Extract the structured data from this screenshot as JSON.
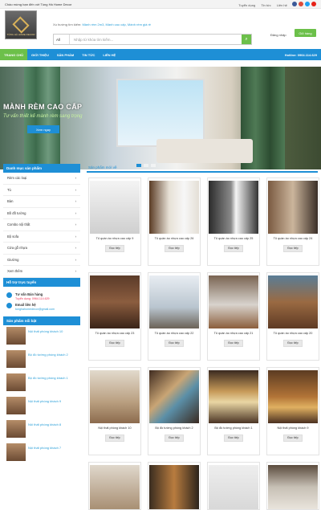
{
  "topbar": {
    "welcome": "Chào mừng bạn đến với Tùng Hà Home Decor",
    "links": [
      "Tuyển dụng",
      "Tin tức",
      "Liên hệ"
    ]
  },
  "logo": {
    "text": "TÙNG HÀ HOME DECOR"
  },
  "search": {
    "keywords_label": "Xu hướng tìm kiếm:",
    "keywords": "Mành rèm 2m3, Mành cao cấp, Mành rèm giá rẻ",
    "category": "All",
    "placeholder": "Nhập từ khóa tìm kiếm..."
  },
  "account": {
    "login": "Đăng nhập",
    "cart": "Giỏ hàng"
  },
  "nav": {
    "items": [
      "TRANG CHỦ",
      "GIỚI THIỆU",
      "SẢN PHẨM",
      "TIN TỨC",
      "LIÊN HỆ"
    ],
    "hotline": "Hotline: 0964.114.629"
  },
  "banner": {
    "title": "MÀNH RÈM CAO CẤP",
    "subtitle": "Tư vấn thiết kế mành rèm sang trọng",
    "button": "Xem ngay"
  },
  "sidebar": {
    "categories_title": "Danh mục sản phẩm",
    "categories": [
      "Rèm các loại",
      "Tủ",
      "Bàn",
      "Bồ đồ tường",
      "Combo nội thất",
      "Bộ sofa",
      "Cửa gỗ nhựa",
      "Giường",
      "Xem thêm"
    ],
    "support_title": "Hỗ trợ trực tuyến",
    "support": {
      "name": "Tư vấn Bán hàng",
      "phone": "Tuyển dụng: 0964.114.629",
      "email_label": "Email liên hệ",
      "email": "tunghahomedecor@gmail.com"
    },
    "featured_title": "Sản phẩm nổi bật",
    "featured": [
      "Nội thất phòng khách 10",
      "Bộ đồ tường phòng khách 2",
      "Bộ đồ tường phòng khách 1",
      "Nội thất phòng khách 9",
      "Nội thất phòng khách 8",
      "Nội thất phòng khách 7"
    ]
  },
  "products": {
    "title": "Sản phẩm mới về",
    "detail_label": "Đọc tiếp",
    "items": [
      "Tủ quần áo nhựa cao cấp 9",
      "Tủ quần áo nhựa cao cấp 26",
      "Tủ quần áo nhựa cao cấp 25",
      "Tủ quần áo nhựa cao cấp 24",
      "Tủ quần áo nhựa cao cấp 23",
      "Tủ quần áo nhựa cao cấp 22",
      "Tủ quần áo nhựa cao cấp 21",
      "Tủ quần áo nhựa cao cấp 20",
      "Nội thất phòng khách 10",
      "Bộ đồ tường phòng khách 2",
      "Bộ đồ tường phòng khách 1",
      "Nội thất phòng khách 9"
    ]
  }
}
